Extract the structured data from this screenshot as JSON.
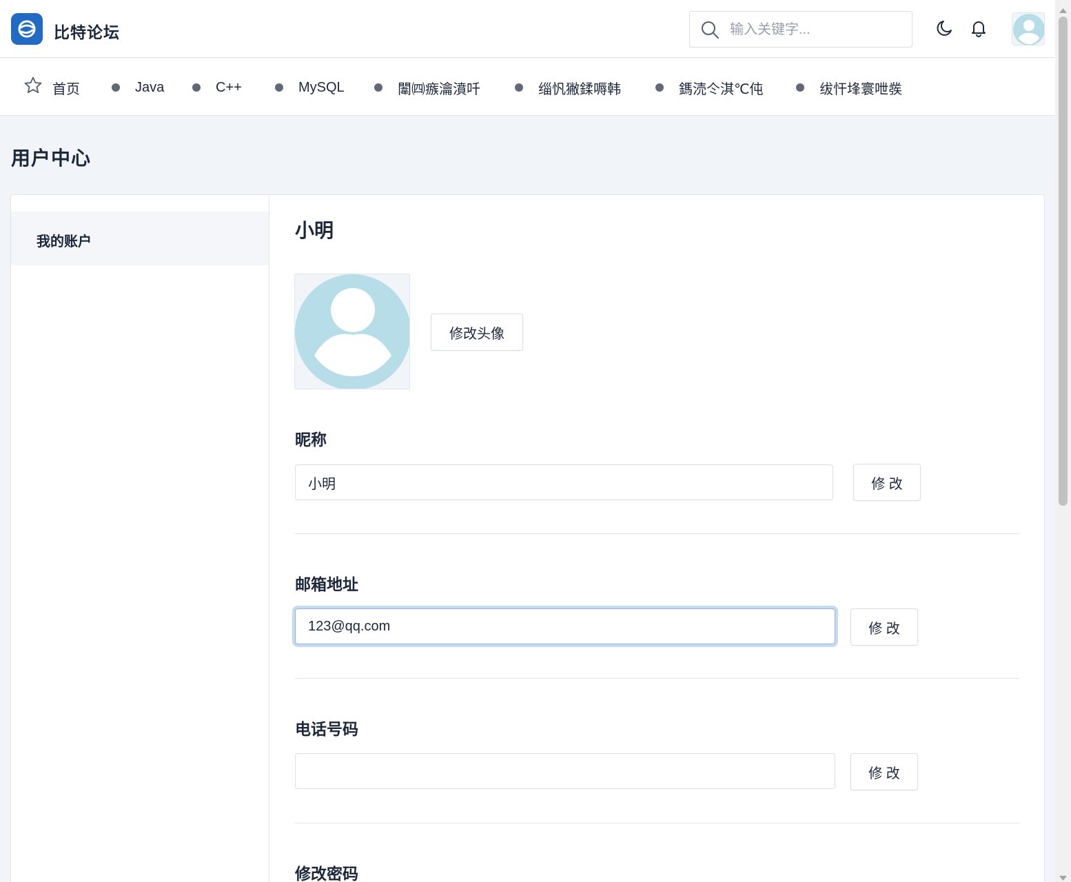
{
  "header": {
    "brand": "比特论坛",
    "search_placeholder": "输入关键字..."
  },
  "nav": {
    "items": [
      {
        "label": "首页"
      },
      {
        "label": "Java"
      },
      {
        "label": "C++"
      },
      {
        "label": "MySQL"
      },
      {
        "label": "闈㈣瘯瀹濆吀"
      },
      {
        "label": "缁忛獙鍒嗕韩"
      },
      {
        "label": "鎷涜仒淇℃伅"
      },
      {
        "label": "绂忓埄寰呭彂"
      }
    ]
  },
  "page": {
    "title": "用户中心"
  },
  "sidebar": {
    "items": [
      {
        "label": "我的账户"
      }
    ]
  },
  "profile": {
    "name": "小明",
    "change_avatar_label": "修改头像",
    "nickname": {
      "label": "昵称",
      "value": "小明",
      "button": "修 改"
    },
    "email": {
      "label": "邮箱地址",
      "value": "123@qq.com",
      "button": "修 改"
    },
    "phone": {
      "label": "电话号码",
      "value": "",
      "button": "修 改"
    },
    "password": {
      "label": "修改密码"
    }
  },
  "colors": {
    "brand": "#206bc4",
    "avatar": "#b7dee8",
    "background": "#f1f4f8"
  }
}
